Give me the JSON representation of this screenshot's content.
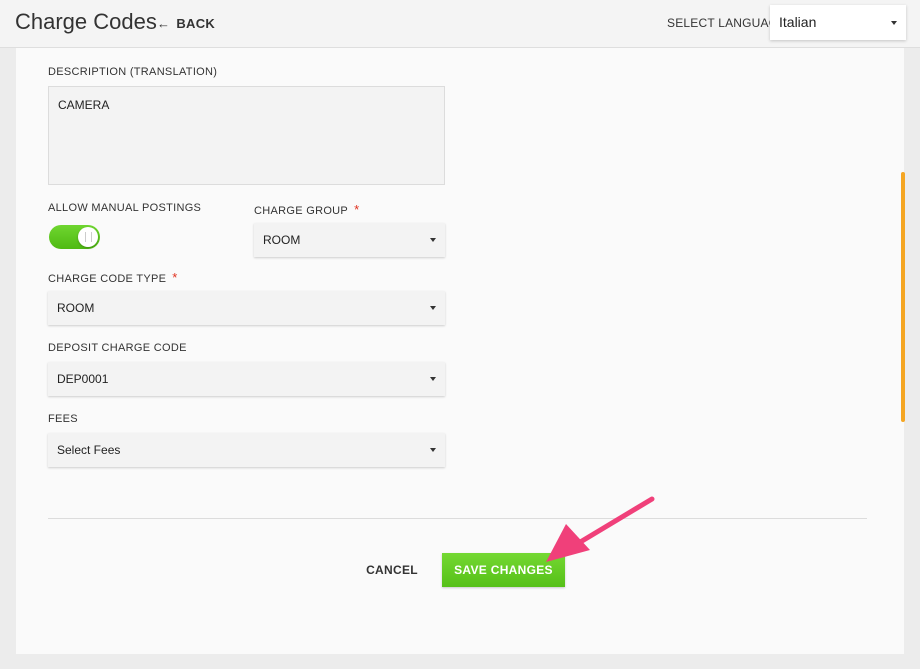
{
  "header": {
    "title": "Charge Codes",
    "back_label": "BACK",
    "language_label": "SELECT LANGUAGE",
    "language_value": "Italian"
  },
  "form": {
    "description_label": "DESCRIPTION (TRANSLATION)",
    "description_value": "CAMERA",
    "allow_manual_postings_label": "ALLOW MANUAL POSTINGS",
    "allow_manual_postings_on": true,
    "charge_group_label": "CHARGE GROUP",
    "charge_group_value": "ROOM",
    "charge_code_type_label": "CHARGE CODE TYPE",
    "charge_code_type_value": "ROOM",
    "deposit_charge_code_label": "DEPOSIT CHARGE CODE",
    "deposit_charge_code_value": "DEP0001",
    "fees_label": "FEES",
    "fees_value": "Select Fees",
    "required_mark": "*"
  },
  "actions": {
    "cancel_label": "CANCEL",
    "save_label": "SAVE CHANGES"
  },
  "colors": {
    "accent_green": "#5cc51f",
    "scroll_accent": "#f5a623",
    "annotation_arrow": "#f0407a",
    "required": "#e0301e"
  },
  "icons": {
    "back": "left-arrow-icon",
    "dropdown": "caret-down-icon"
  }
}
